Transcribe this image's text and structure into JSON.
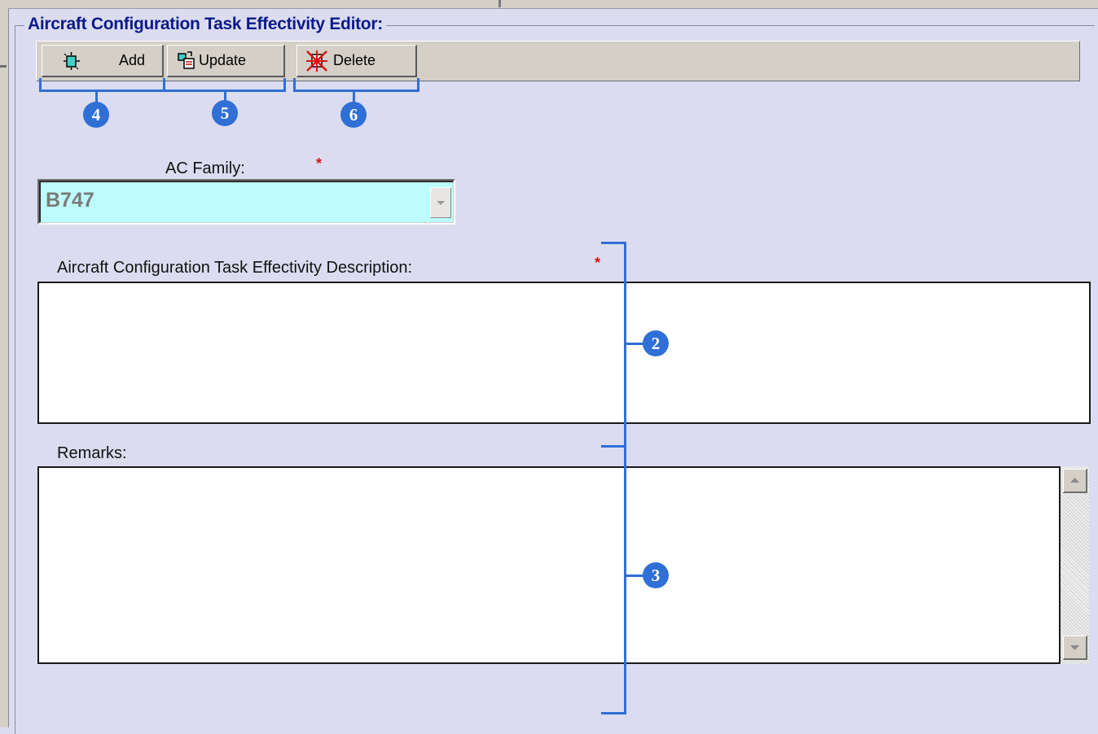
{
  "editor": {
    "title": "Aircraft Configuration Task Effectivity Editor:"
  },
  "toolbar": {
    "add_label": "Add",
    "update_label": "Update",
    "delete_label": "Delete"
  },
  "callouts": {
    "c2": "2",
    "c3": "3",
    "c4": "4",
    "c5": "5",
    "c6": "6"
  },
  "form": {
    "ac_family": {
      "label": "AC Family:",
      "required_mark": "*",
      "value": "B747"
    },
    "description": {
      "label": "Aircraft Configuration Task Effectivity Description:",
      "required_mark": "*",
      "value": ""
    },
    "remarks": {
      "label": "Remarks:",
      "value": ""
    }
  },
  "colors": {
    "background": "#dcdcf0",
    "title": "#0a1a8a",
    "combo_fill": "#bdfcfc",
    "callout": "#2f6fd6",
    "required": "#e01010"
  },
  "icons": {
    "add": "add-record-icon",
    "update": "update-record-icon",
    "delete": "delete-record-icon"
  }
}
